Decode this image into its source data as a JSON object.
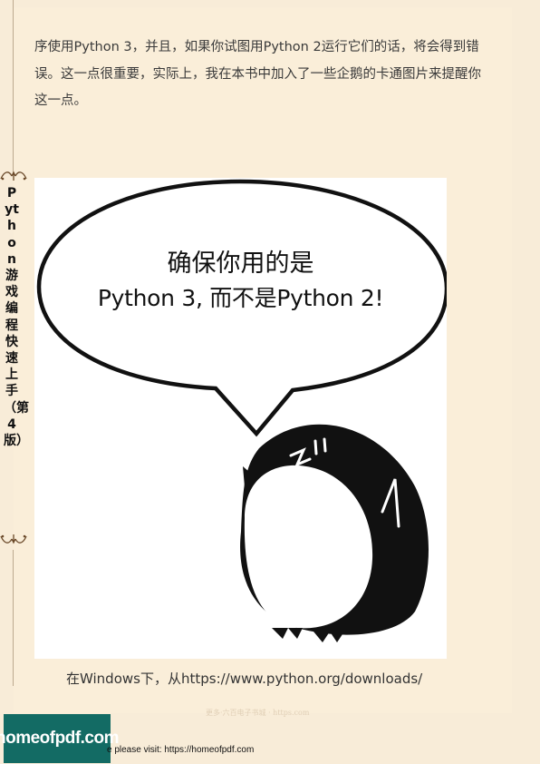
{
  "body_text": "序使用Python 3，并且，如果你试图用Python 2运行它们的话，将会得到错误。这一点很重要，实际上，我在本书中加入了一些企鹅的卡通图片来提醒你这一点。",
  "side_title": "Python游戏编程快速上手（第4版）",
  "figure": {
    "bubble_line1": "确保你用的是",
    "bubble_line2": "Python 3, 而不是Python 2!"
  },
  "caption": "在Windows下，从https://www.python.org/downloads/",
  "watermark": "更多·六百电子书城 · https.com",
  "logo_text": "homeofpdf.com",
  "footer_note": "e please visit: https://homeofpdf.com",
  "colors": {
    "page_background": "#f8ecd8",
    "logo_background": "#136b64"
  },
  "icons": [
    "ornament-flourish-icon",
    "penguin-illustration",
    "speech-bubble"
  ]
}
